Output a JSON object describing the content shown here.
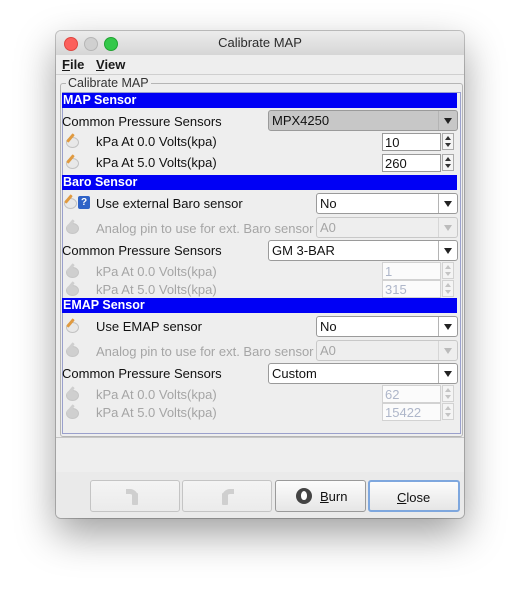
{
  "window": {
    "title": "Calibrate MAP"
  },
  "menubar": {
    "file": {
      "first": "F",
      "rest": "ile"
    },
    "view": {
      "first": "V",
      "rest": "iew"
    }
  },
  "panel_title": "Calibrate MAP",
  "map_sensor": {
    "header": "MAP Sensor",
    "common_label": "Common Pressure Sensors",
    "common_value": "MPX4250",
    "kpa0_label": "kPa At 0.0 Volts(kpa)",
    "kpa0_value": "10",
    "kpa5_label": "kPa At 5.0 Volts(kpa)",
    "kpa5_value": "260"
  },
  "baro_sensor": {
    "header": "Baro Sensor",
    "use_ext_label": "Use external Baro sensor",
    "use_ext_value": "No",
    "analog_label": "Analog pin to use for ext. Baro sensor",
    "analog_value": "A0",
    "common_label": "Common Pressure Sensors",
    "common_value": "GM 3-BAR",
    "kpa0_label": "kPa At 0.0 Volts(kpa)",
    "kpa0_value": "1",
    "kpa5_label": "kPa At 5.0 Volts(kpa)",
    "kpa5_value": "315"
  },
  "emap_sensor": {
    "header": "EMAP Sensor",
    "use_label": "Use EMAP sensor",
    "use_value": "No",
    "analog_label": "Analog pin to use for ext. Baro sensor",
    "analog_value": "A0",
    "common_label": "Common Pressure Sensors",
    "common_value": "Custom",
    "kpa0_label": "kPa At 0.0 Volts(kpa)",
    "kpa0_value": "62",
    "kpa5_label": "kPa At 5.0 Volts(kpa)",
    "kpa5_value": "15422"
  },
  "buttons": {
    "burn": {
      "first": "B",
      "rest": "urn"
    },
    "close": {
      "first": "C",
      "rest": "lose"
    }
  },
  "icons": {
    "undo": "undo-icon",
    "redo": "redo-icon",
    "burn": "fire-icon",
    "help": "help-icon",
    "edit": "pencil-icon"
  },
  "colors": {
    "section_header_bg": "#0000f5",
    "section_header_text": "#ffffff"
  }
}
